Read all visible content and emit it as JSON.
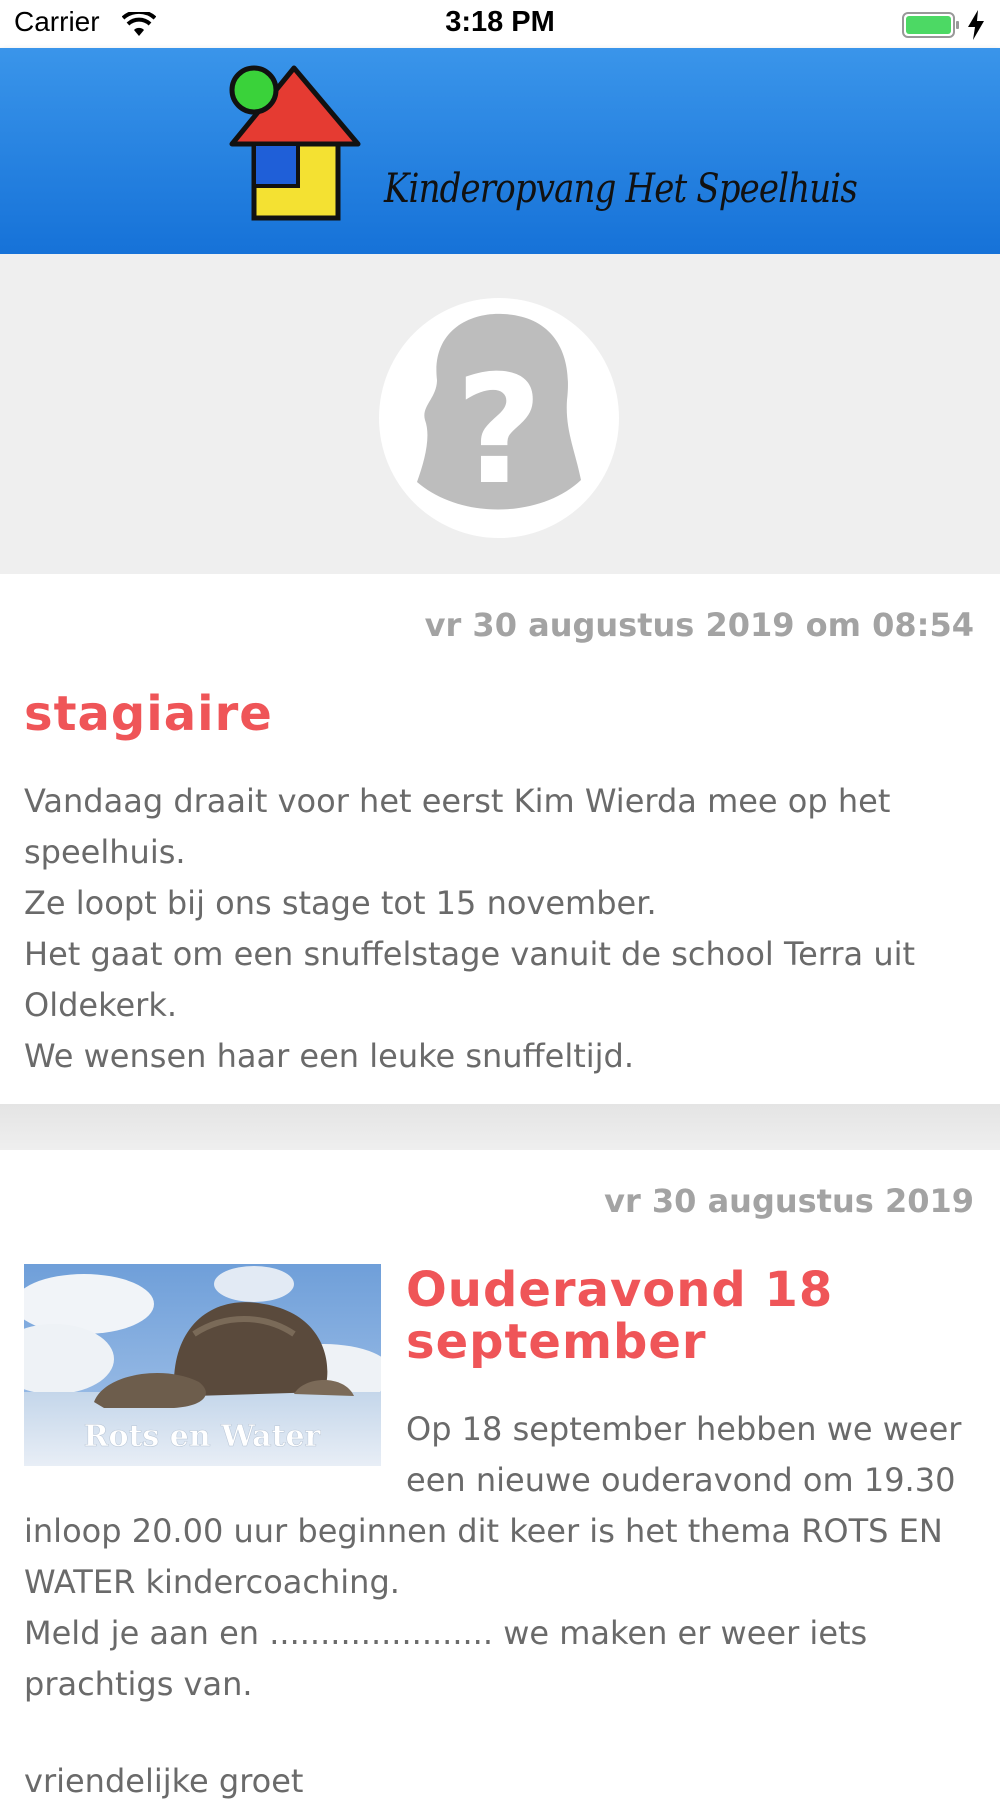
{
  "status_bar": {
    "carrier": "Carrier",
    "time": "3:18 PM"
  },
  "header": {
    "brand_name": "Kinderopvang Het Speelhuis"
  },
  "posts": [
    {
      "date": "vr 30 augustus 2019 om 08:54",
      "title": "stagiaire",
      "body": "Vandaag draait voor het eerst Kim Wierda mee op het speelhuis.\nZe loopt bij ons stage tot 15 november.\nHet gaat om een snuffelstage vanuit de school Terra uit Oldekerk.\nWe wensen haar een leuke snuffeltijd."
    },
    {
      "date": "vr 30 augustus 2019",
      "title_line1": "Ouderavond 18",
      "title_line2": "september",
      "image_caption": "Rots en Water",
      "body_wrap1": "Op 18 september hebben we weer",
      "body_wrap2": "een nieuwe ouderavond om 19.30",
      "body_rest": "inloop 20.00 uur beginnen dit keer is het thema ROTS EN WATER kindercoaching.\nMeld je aan en ...................... we maken er weer iets prachtigs van.",
      "body_tail": "vriendelijke groet"
    }
  ],
  "colors": {
    "header_blue": "#2a86e4",
    "title_red": "#ef5558",
    "date_gray": "#a3a3a3"
  }
}
